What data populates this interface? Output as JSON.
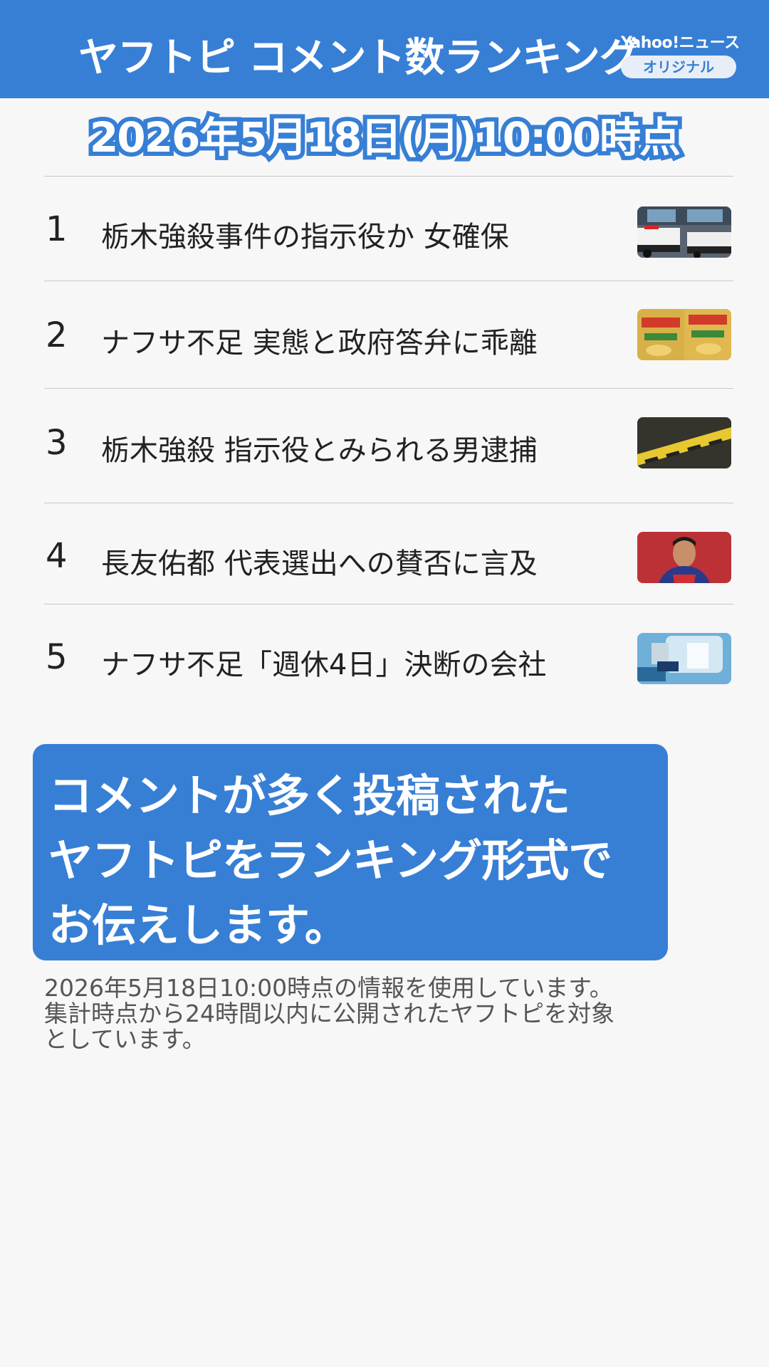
{
  "header": {
    "title": "ヤフトピ コメント数ランキング",
    "brand_name": "Yahoo!ニュース",
    "brand_badge": "オリジナル",
    "background_color": "#377fd5"
  },
  "date_title": "2026年5月18日(月)10:00時点",
  "ranking": [
    {
      "rank": "1",
      "headline": "栃木強殺事件の指示役か 女確保",
      "thumbnail_icon": "police-cars-image"
    },
    {
      "rank": "2",
      "headline": "ナフサ不足 実態と政府答弁に乖離",
      "thumbnail_icon": "snack-bags-image"
    },
    {
      "rank": "3",
      "headline": "栃木強殺 指示役とみられる男逮捕",
      "thumbnail_icon": "keep-out-tape-image"
    },
    {
      "rank": "4",
      "headline": "長友佑都 代表選出への賛否に言及",
      "thumbnail_icon": "soccer-player-image"
    },
    {
      "rank": "5",
      "headline": "ナフサ不足「週休4日」決断の会社",
      "thumbnail_icon": "bottle-image"
    }
  ],
  "callout": {
    "lines": [
      "コメントが多く投稿された",
      "ヤフトピをランキング形式で",
      "お伝えします。"
    ]
  },
  "footnote": {
    "lines": [
      "2026年5月18日10:00時点の情報を使用しています。",
      "集計時点から24時間以内に公開されたヤフトピを対象",
      "としています。"
    ]
  }
}
